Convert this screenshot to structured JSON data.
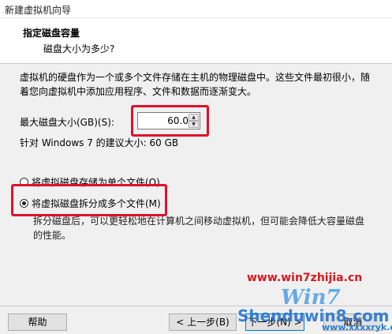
{
  "window": {
    "title": "新建虚拟机向导"
  },
  "header": {
    "title": "指定磁盘容量",
    "subtitle": "磁盘大小为多少?"
  },
  "body": {
    "description": "虚拟机的硬盘作为一个或多个文件存储在主机的物理磁盘中。这些文件最初很小，随着您向虚拟机中添加应用程序、文件和数据而逐渐变大。",
    "size_label": "最大磁盘大小(GB)(S):",
    "size_value": "60.0",
    "recommend": "针对 Windows 7 的建议大小: 60 GB",
    "option_single": "将虚拟磁盘存储为单个文件(O)",
    "option_multi": "将虚拟磁盘拆分成多个文件(M)",
    "multi_help": "拆分磁盘后，可以更轻松地在计算机之间移动虚拟机，但可能会降低大容量磁盘的性能。",
    "selected_option": "multi"
  },
  "footer": {
    "help": "帮助",
    "back": "< 上一步(B)",
    "next": "下一步(N) >",
    "cancel": "取消"
  },
  "watermark": {
    "site1": "www.win7zhijia.cn",
    "logo": "Win7",
    "site2": "Shenduwin8.com",
    "site3": "www.xxxxryk.com"
  },
  "colors": {
    "highlight_box": "#e0102a",
    "panel_bg": "#f0f0f0",
    "header_bg": "#ffffff"
  }
}
